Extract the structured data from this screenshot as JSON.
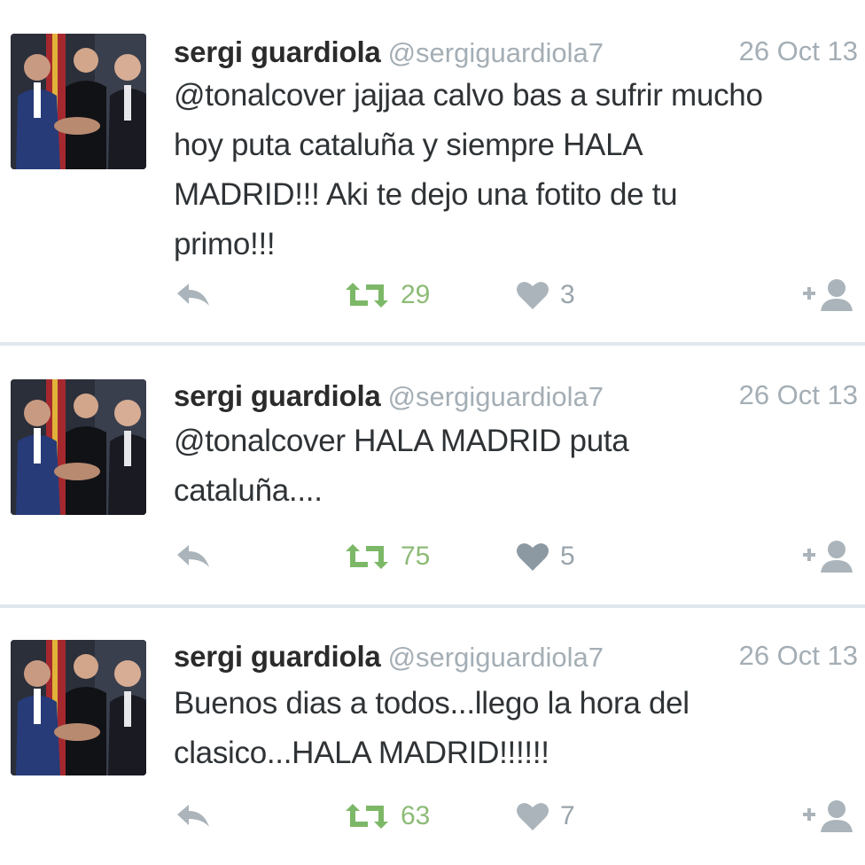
{
  "tweets": [
    {
      "name": "sergi guardiola",
      "handle": "@sergiguardiola7",
      "date": "26 Oct 13",
      "text_lines": [
        "@tonalcover jajjaa calvo bas a sufrir mucho",
        "hoy puta cataluña y siempre HALA",
        "MADRID!!! Aki te dejo una fotito de tu",
        "primo!!!"
      ],
      "retweets": "29",
      "likes": "3"
    },
    {
      "name": "sergi guardiola",
      "handle": "@sergiguardiola7",
      "date": "26 Oct 13",
      "text_lines": [
        "@tonalcover HALA MADRID puta",
        "cataluña...."
      ],
      "retweets": "75",
      "likes": "5"
    },
    {
      "name": "sergi guardiola",
      "handle": "@sergiguardiola7",
      "date": "26 Oct 13",
      "text_lines": [
        "Buenos dias a todos...llego la hora del",
        "clasico...HALA MADRID!!!!!!"
      ],
      "retweets": "63",
      "likes": "7"
    }
  ],
  "icons": {
    "reply": "reply-icon",
    "retweet": "retweet-icon",
    "like": "heart-icon",
    "follow": "follow-user-icon"
  },
  "colors": {
    "retweet": "#7cb867",
    "muted": "#a4aeb5",
    "text": "#2f3336",
    "divider": "#e1e8ed"
  }
}
